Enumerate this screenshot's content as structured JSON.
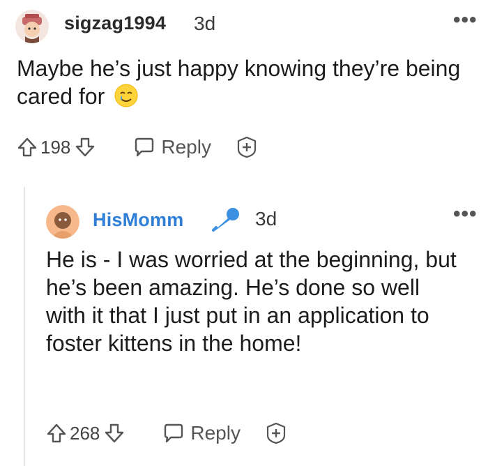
{
  "comments": [
    {
      "username": "sigzag1994",
      "time": "3d",
      "body": "Maybe he’s just happy knowing they’re being cared for",
      "score": "198",
      "reply_label": "Reply",
      "more_label": "•••"
    },
    {
      "username": "HisMomm",
      "time": "3d",
      "body": "He is - I was worried at the beginning, but he’s been amazing. He’s done so well with it that I just put in an application to foster kittens in the home!",
      "score": "268",
      "reply_label": "Reply",
      "more_label": "•••"
    }
  ],
  "colors": {
    "username_op": "#2f7fd6",
    "mic_badge": "#3d8fe0",
    "text": "#1c1c1c",
    "icon_gray": "#555555"
  },
  "icons": [
    "upvote-icon",
    "downvote-icon",
    "reply-bubble-icon",
    "award-plus-icon",
    "microphone-icon",
    "smiling-tear-emoji"
  ]
}
